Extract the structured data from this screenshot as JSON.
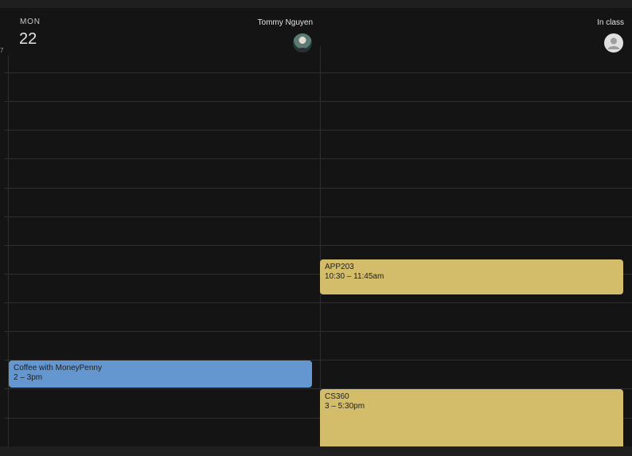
{
  "day": {
    "abbr": "MON",
    "number": "22"
  },
  "hour_label": "7",
  "people": [
    {
      "name": "Tommy Nguyen",
      "status": "",
      "avatar": "photo"
    },
    {
      "name": "In class",
      "avatar": "person-icon"
    }
  ],
  "events": [
    {
      "title": "APP203",
      "time": "10:30 – 11:45am",
      "color": "#d3bd6a",
      "column": "right"
    },
    {
      "title": "Coffee with MoneyPenny",
      "time": "2 – 3pm",
      "color": "#6496cf",
      "column": "left"
    },
    {
      "title": "CS360",
      "time": "3 – 5:30pm",
      "color": "#d3bd6a",
      "column": "right"
    }
  ],
  "colors": {
    "background": "#141414",
    "gridline": "#2e2e2e",
    "event_yellow": "#d3bd6a",
    "event_blue": "#6496cf"
  }
}
